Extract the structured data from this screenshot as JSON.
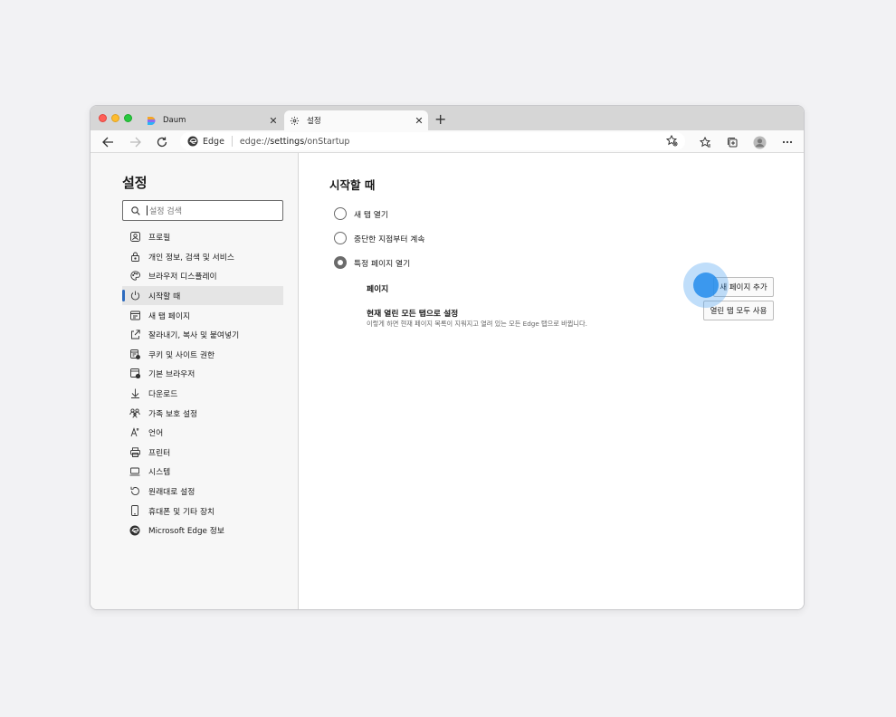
{
  "tabs": [
    {
      "title": "Daum",
      "active": false
    },
    {
      "title": "설정",
      "active": true
    }
  ],
  "address": {
    "identity": "Edge",
    "url_prefix": "edge://",
    "url_main": "settings",
    "url_suffix": "/onStartup"
  },
  "sidebar": {
    "title": "설정",
    "search_placeholder": "설정 검색",
    "items": [
      {
        "label": "프로필",
        "icon": "profile-icon",
        "active": false
      },
      {
        "label": "개인 정보, 검색 및 서비스",
        "icon": "lock-icon",
        "active": false
      },
      {
        "label": "브라우저 디스플레이",
        "icon": "palette-icon",
        "active": false
      },
      {
        "label": "시작할 때",
        "icon": "power-icon",
        "active": true
      },
      {
        "label": "새 탭 페이지",
        "icon": "new-tab-icon",
        "active": false
      },
      {
        "label": "잘라내기, 복사 및 붙여넣기",
        "icon": "share-icon",
        "active": false
      },
      {
        "label": "쿠키 및 사이트 권한",
        "icon": "cookie-permissions-icon",
        "active": false
      },
      {
        "label": "기본 브라우저",
        "icon": "default-browser-icon",
        "active": false
      },
      {
        "label": "다운로드",
        "icon": "download-icon",
        "active": false
      },
      {
        "label": "가족 보호 설정",
        "icon": "family-icon",
        "active": false
      },
      {
        "label": "언어",
        "icon": "language-icon",
        "active": false
      },
      {
        "label": "프린터",
        "icon": "printer-icon",
        "active": false
      },
      {
        "label": "시스템",
        "icon": "laptop-icon",
        "active": false
      },
      {
        "label": "원래대로 설정",
        "icon": "reset-icon",
        "active": false
      },
      {
        "label": "휴대폰 및 기타 장치",
        "icon": "phone-icon",
        "active": false
      },
      {
        "label": "Microsoft Edge 정보",
        "icon": "edge-icon",
        "active": false
      }
    ]
  },
  "main": {
    "title": "시작할 때",
    "options": [
      {
        "label": "새 탭 열기",
        "checked": false
      },
      {
        "label": "중단한 지점부터 계속",
        "checked": false
      },
      {
        "label": "특정 페이지 열기",
        "checked": true
      }
    ],
    "pages_label": "페이지",
    "add_page_button": "새 페이지 추가",
    "open_tabs_title": "현재 열린 모든 탭으로 설정",
    "open_tabs_desc": "이렇게 하면 현재 페이지 목록이 지워지고 열려 있는 모든 Edge 탭으로 바뀝니다.",
    "use_open_tabs_button": "열린 탭 모두 사용"
  },
  "colors": {
    "accent": "#2d6bbf",
    "click_indicator": "#2b8ceb"
  }
}
